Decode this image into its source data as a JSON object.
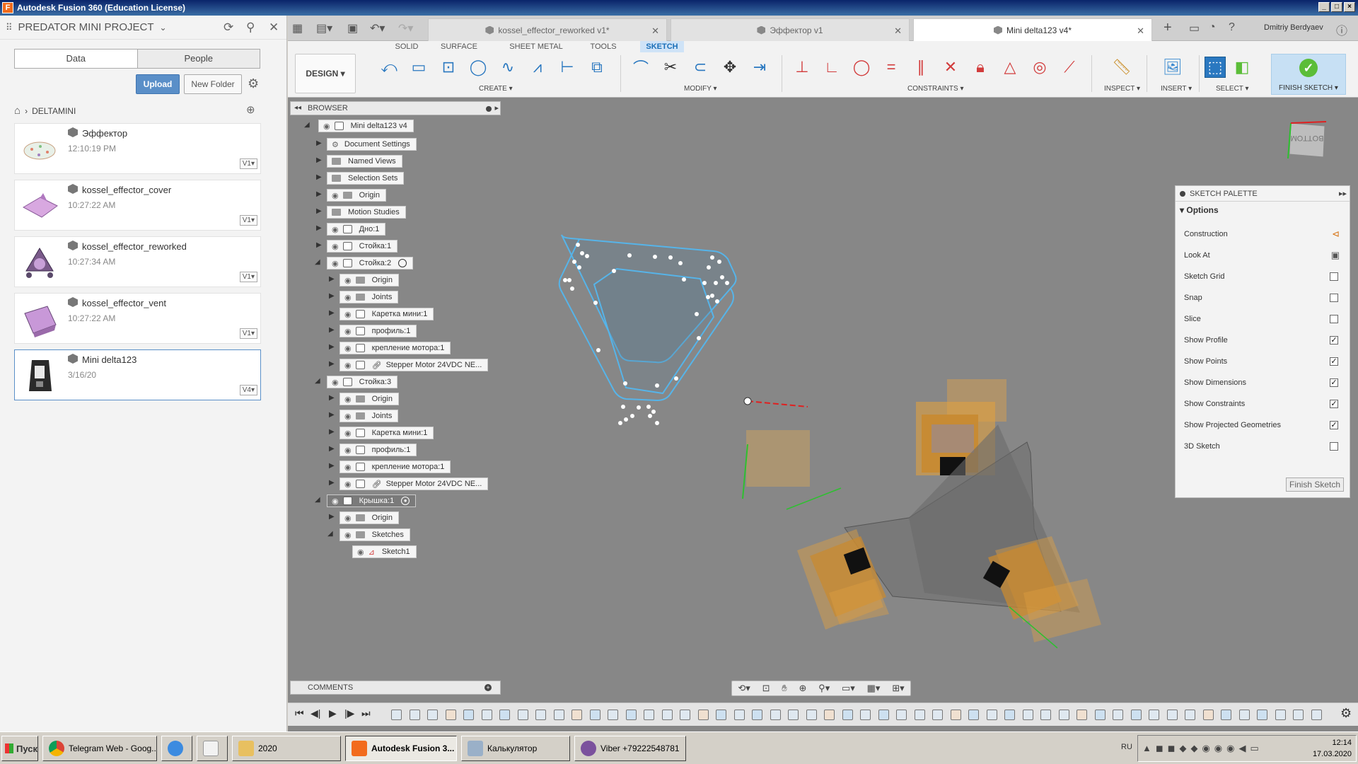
{
  "window": {
    "title": "Autodesk Fusion 360 (Education License)",
    "logo": "F"
  },
  "data_panel": {
    "project": "PREDATOR MINI PROJECT",
    "tabs": [
      "Data",
      "People"
    ],
    "upload": "Upload",
    "new_folder": "New Folder",
    "breadcrumb": "DELTAMINI",
    "files": [
      {
        "name": "Эффектор",
        "time": "12:10:19 PM",
        "version": "V1"
      },
      {
        "name": "kossel_effector_cover",
        "time": "10:27:22 AM",
        "version": "V1"
      },
      {
        "name": "kossel_effector_reworked",
        "time": "10:27:34 AM",
        "version": "V1"
      },
      {
        "name": "kossel_effector_vent",
        "time": "10:27:22 AM",
        "version": "V1"
      },
      {
        "name": "Mini delta123",
        "time": "3/16/20",
        "version": "V4"
      }
    ]
  },
  "doc_tabs": [
    "kossel_effector_reworked v1*",
    "Эффектор v1",
    "Mini delta123 v4*"
  ],
  "user": "Dmitriy Berdyaev",
  "toolbar": {
    "workspace_tabs": [
      "SOLID",
      "SURFACE",
      "SHEET METAL",
      "TOOLS",
      "SKETCH"
    ],
    "design": "DESIGN ▾",
    "groups": [
      "CREATE ▾",
      "MODIFY ▾",
      "CONSTRAINTS ▾",
      "INSPECT ▾",
      "INSERT ▾",
      "SELECT ▾",
      "FINISH SKETCH ▾"
    ]
  },
  "browser": {
    "title": "BROWSER",
    "nodes": [
      "Mini delta123 v4",
      "Document Settings",
      "Named Views",
      "Selection Sets",
      "Origin",
      "Motion Studies",
      "Дно:1",
      "Стойка:1",
      "Стойка:2",
      "Origin",
      "Joints",
      "Каретка мини:1",
      "профиль:1",
      "крепление мотора:1",
      "Stepper Motor 24VDC NE...",
      "Стойка:3",
      "Origin",
      "Joints",
      "Каретка мини:1",
      "профиль:1",
      "крепление мотора:1",
      "Stepper Motor 24VDC NE...",
      "Крышка:1",
      "Origin",
      "Sketches",
      "Sketch1"
    ]
  },
  "comments": "COMMENTS",
  "palette": {
    "title": "SKETCH PALETTE",
    "options_label": "Options",
    "rows": [
      {
        "label": "Construction",
        "kind": "icon",
        "icon": "construction-line-icon"
      },
      {
        "label": "Look At",
        "kind": "icon",
        "icon": "look-at-icon"
      },
      {
        "label": "Sketch Grid",
        "kind": "check",
        "checked": false
      },
      {
        "label": "Snap",
        "kind": "check",
        "checked": false
      },
      {
        "label": "Slice",
        "kind": "check",
        "checked": false
      },
      {
        "label": "Show Profile",
        "kind": "check",
        "checked": true
      },
      {
        "label": "Show Points",
        "kind": "check",
        "checked": true
      },
      {
        "label": "Show Dimensions",
        "kind": "check",
        "checked": true
      },
      {
        "label": "Show Constraints",
        "kind": "check",
        "checked": true
      },
      {
        "label": "Show Projected Geometries",
        "kind": "check",
        "checked": true
      },
      {
        "label": "3D Sketch",
        "kind": "check",
        "checked": false
      }
    ],
    "finish": "Finish Sketch"
  },
  "viewcube": "BOTTOM",
  "taskbar": {
    "start": "Пуск",
    "items": [
      "Telegram Web - Goog...",
      "",
      "",
      "2020",
      "Autodesk Fusion 3...",
      "Калькулятор",
      "Viber +79222548781"
    ],
    "lang": "RU",
    "time": "12:14",
    "date": "17.03.2020"
  },
  "colors": {
    "sketch_blue": "#56b4e9",
    "accent": "#1a6fb8",
    "finish_green": "#5bbd38"
  }
}
